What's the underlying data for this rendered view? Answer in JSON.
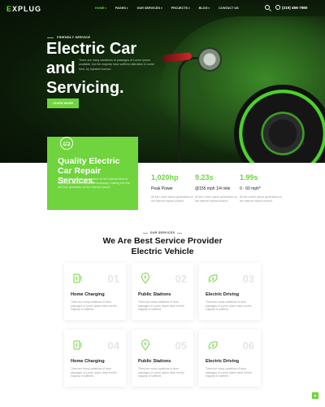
{
  "brand": {
    "logo_prefix": "E",
    "logo_rest": "XPLUG",
    "accent": "#6fd43d"
  },
  "nav": {
    "items": [
      {
        "label": "HOME",
        "dropdown": true,
        "active": true
      },
      {
        "label": "PAGES",
        "dropdown": true
      },
      {
        "label": "OUR SERVICES",
        "dropdown": true
      },
      {
        "label": "PROJECTS",
        "dropdown": true
      },
      {
        "label": "BLOG",
        "dropdown": true
      },
      {
        "label": "CONTACT US",
        "dropdown": false
      }
    ],
    "phone": "(319) 456-7980"
  },
  "hero": {
    "eyebrow": "FRIENDLY SERVICE",
    "title_line1": "Electric Car",
    "title_line2": "and",
    "title_line3": "Servicing.",
    "description": "There are many variations of passages of Lorem Ipsum available, but the majority have suffered alteration in some form, by injected humour.",
    "button": "LEARN MORE"
  },
  "feature": {
    "icon": "car-repair-icon",
    "title": "Quality Electric Car Repair Services.",
    "description": "All the Lorem Ipsum generators on the Internet tend to repeat predefined chunks as necessary, making this the first true generator on the Internet Ipsum."
  },
  "stats": [
    {
      "value": "1,020hp",
      "label": "Peak Power",
      "desc": "All the Lorem Ipsum generators on the Internet repeat content."
    },
    {
      "value": "9.23s",
      "label": "@155 mph 1/4 mile",
      "desc": "All the Lorem Ipsum generators on the Internet repeat content."
    },
    {
      "value": "1.99s",
      "label": "0 - 60 mph*",
      "desc": "All the Lorem Ipsum generators on the Internet repeat content."
    }
  ],
  "services": {
    "eyebrow": "OUR SERVICES",
    "title_line1": "We Are Best Service Provider",
    "title_line2": "Electric Vehicle",
    "cards": [
      {
        "num": "01",
        "title": "Home Charging",
        "icon": "charging-station-icon",
        "desc": "There are many variations of Isum passages of Lorem Ipsum have but the majority of suffered."
      },
      {
        "num": "02",
        "title": "Public Stations",
        "icon": "location-pin-icon",
        "desc": "There are many variations of Isum passages of Lorem Ipsum have but the majority of suffered."
      },
      {
        "num": "03",
        "title": "Electric Driving",
        "icon": "electric-car-icon",
        "desc": "There are many variations of Isum passages of Lorem Ipsum have but the majority of suffered."
      },
      {
        "num": "04",
        "title": "Home Charging",
        "icon": "charging-station-icon",
        "desc": "There are many variations of Isum passages of Lorem Ipsum have but the majority of suffered."
      },
      {
        "num": "05",
        "title": "Public Stations",
        "icon": "location-pin-icon",
        "desc": "There are many variations of Isum passages of Lorem Ipsum have but the majority of suffered."
      },
      {
        "num": "06",
        "title": "Electric Driving",
        "icon": "electric-car-icon",
        "desc": "There are many variations of Isum passages of Lorem Ipsum have but the majority of suffered."
      }
    ]
  }
}
